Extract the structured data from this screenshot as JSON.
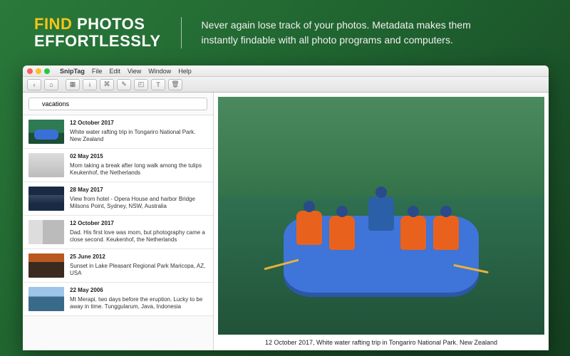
{
  "hero": {
    "headline_accent": "FIND",
    "headline_rest_1": "PHOTOS",
    "headline_rest_2": "EFFORTLESSLY",
    "sub": "Never again lose track of your photos. Metadata makes them instantly findable with all photo programs and computers."
  },
  "menubar": {
    "app": "SnipTag",
    "items": [
      "File",
      "Edit",
      "View",
      "Window",
      "Help"
    ]
  },
  "toolbar": {
    "icons": [
      "home-icon",
      "grid-icon",
      "info-icon",
      "tag-icon",
      "edit-icon",
      "crop-icon",
      "text-icon",
      "trash-icon"
    ]
  },
  "search": {
    "placeholder": "",
    "value": "vacations"
  },
  "results": [
    {
      "date": "12 October 2017",
      "caption": "White water rafting trip in Tongariro National Park.\nNew Zealand",
      "thumb": "th-raft"
    },
    {
      "date": "02 May 2015",
      "caption": "Mom taking a break after long walk among the tulips\nKeukenhof, the Netherlands",
      "thumb": "th-mom"
    },
    {
      "date": "28 May 2017",
      "caption": "View from hotel - Opera House and harbor Bridge\nMilsons Point, Sydney, NSW, Australia",
      "thumb": "th-bridge"
    },
    {
      "date": "12 October 2017",
      "caption": "Dad. His first love was mom, but photography came a close second.\nKeukenhof, the Netherlands",
      "thumb": "th-dad"
    },
    {
      "date": "25 June 2012",
      "caption": "Sunset in Lake Pleasant Regional Park\nMaricopa, AZ, USA",
      "thumb": "th-sunset"
    },
    {
      "date": "22 May 2006",
      "caption": "Mt Merapi, two days before the eruption. Lucky to be away in time.\nTunggularum, Java, Indonesia",
      "thumb": "th-eruption"
    }
  ],
  "preview": {
    "caption": "12 October 2017, White water rafting trip in Tongariro National Park. New Zealand"
  }
}
